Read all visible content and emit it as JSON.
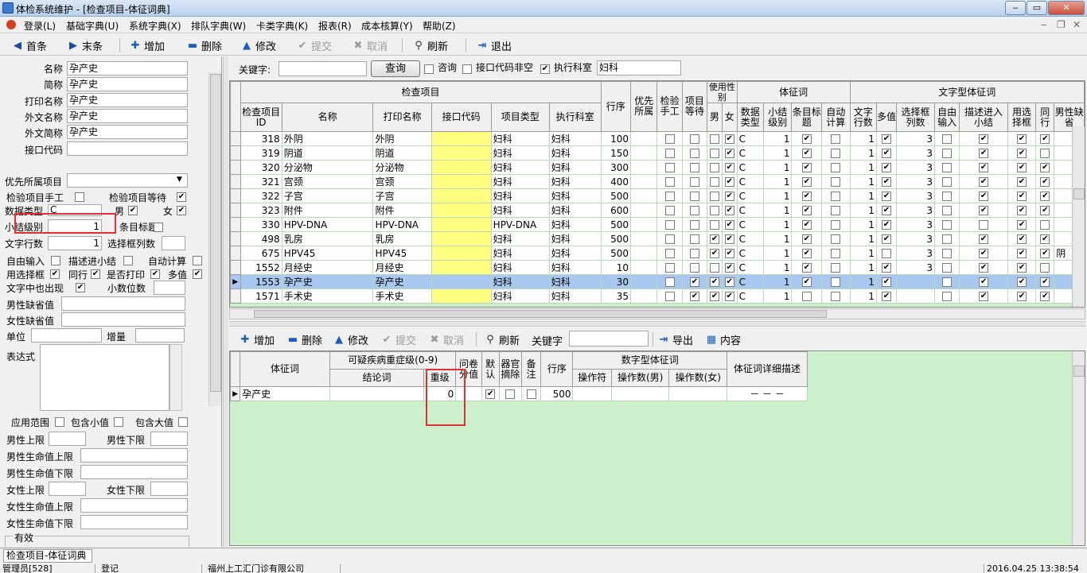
{
  "window": {
    "title": "体检系统维护 - [检查项目-体征词典]",
    "min": "‒",
    "max": "▭",
    "close": "✕"
  },
  "menu": [
    "登录(L)",
    "基础字典(U)",
    "系统字典(X)",
    "排队字典(W)",
    "卡类字典(K)",
    "报表(R)",
    "成本核算(Y)",
    "帮助(Z)"
  ],
  "mdi": {
    "min": "‒",
    "restore": "❐",
    "close": "✕"
  },
  "toolbar1": {
    "first": "首条",
    "last": "末条",
    "add": "增加",
    "delete": "删除",
    "edit": "修改",
    "submit": "提交",
    "cancel": "取消",
    "refresh": "刷新",
    "exit": "退出"
  },
  "form": {
    "name_label": "名称",
    "name": "孕产史",
    "short_label": "简称",
    "short": "孕产史",
    "print_label": "打印名称",
    "print": "孕产史",
    "foreign_label": "外文名称",
    "foreign": "孕产史",
    "foreign_short_label": "外文简称",
    "foreign_short": "孕产史",
    "iface_label": "接口代码",
    "iface": "",
    "priority_label": "优先所属项目",
    "priority": "",
    "manual_label": "检验项目手工",
    "wait_label": "检验项目等待",
    "dtype_label": "数据类型",
    "dtype": "C",
    "male_label": "男",
    "female_label": "女",
    "level_label": "小结级别",
    "level": "1",
    "title_label": "条目标题",
    "lines_label": "文字行数",
    "lines": "1",
    "colcount_label": "选择框列数",
    "colcount": "",
    "free_label": "自由输入",
    "desc_label": "描述进小结",
    "autocalc_label": "自动计算",
    "usebox_label": "用选择框",
    "sameline_label": "同行",
    "printyn_label": "是否打印",
    "multi_label": "多值",
    "textshow_label": "文字中也出现",
    "decimals_label": "小数位数",
    "decimals": "",
    "male_def_label": "男性缺省值",
    "male_def": "",
    "female_def_label": "女性缺省值",
    "female_def": "",
    "unit_label": "单位",
    "unit": "",
    "inc_label": "增量",
    "inc": "",
    "expr_label": "表达式",
    "expr": "",
    "range_label": "应用范围",
    "incmin_label": "包含小值",
    "incmax_label": "包含大值",
    "m_up_label": "男性上限",
    "m_up": "",
    "m_low_label": "男性下限",
    "m_low": "",
    "m_life_up_label": "男性生命值上限",
    "m_life_up": "",
    "m_life_low_label": "男性生命值下限",
    "m_life_low": "",
    "f_up_label": "女性上限",
    "f_up": "",
    "f_low_label": "女性下限",
    "f_low": "",
    "f_life_up_label": "女性生命值上限",
    "f_life_up": "",
    "f_life_low_label": "女性生命值下限",
    "f_life_low": "",
    "valid_label": "有效"
  },
  "search": {
    "kw_label": "关键字:",
    "kw": "",
    "query": "查询",
    "consult": "咨询",
    "iface_non": "接口代码非空",
    "dept": "执行科室",
    "dept_value": "妇科"
  },
  "grid1": {
    "group_main": "检查项目",
    "group_gender": "使用性别",
    "group_sign": "体征词",
    "group_text": "文字型体征词",
    "h_id": "检查项目ID",
    "h_name": "名称",
    "h_print": "打印名称",
    "h_iface": "接口代码",
    "h_type": "项目类型",
    "h_dept": "执行科室",
    "h_order": "行序",
    "h_pri": "优先所属",
    "h_manual": "检验手工",
    "h_wait": "项目等待",
    "h_m": "男",
    "h_f": "女",
    "h_dtype": "数据类型",
    "h_lvl": "小结级别",
    "h_ttl": "条目标题",
    "h_auto": "自动计算",
    "h_lines": "文字行数",
    "h_multi": "多值",
    "h_cols": "选择框列数",
    "h_free": "自由输入",
    "h_desc": "描述进入小结",
    "h_use": "用选择框",
    "h_same": "同行",
    "h_mdef": "男性缺省",
    "rows": [
      {
        "id": "318",
        "name": "外阴",
        "print": "外阴",
        "type": "妇科",
        "dept": "妇科",
        "order": "100",
        "pri": "",
        "manual": "",
        "wait": "",
        "m": "",
        "f": "✔",
        "dt": "C",
        "lvl": "1",
        "ttl": "✔",
        "auto": "",
        "lines": "1",
        "multi": "✔",
        "cols": "3",
        "free": "",
        "desc": "✔",
        "use": "✔",
        "same": "✔",
        "mdef": ""
      },
      {
        "id": "319",
        "name": "阴道",
        "print": "阴道",
        "type": "妇科",
        "dept": "妇科",
        "order": "150",
        "pri": "",
        "manual": "",
        "wait": "",
        "m": "",
        "f": "✔",
        "dt": "C",
        "lvl": "1",
        "ttl": "✔",
        "auto": "",
        "lines": "1",
        "multi": "✔",
        "cols": "3",
        "free": "",
        "desc": "✔",
        "use": "✔",
        "same": "",
        "mdef": ""
      },
      {
        "id": "320",
        "name": "分泌物",
        "print": "分泌物",
        "type": "妇科",
        "dept": "妇科",
        "order": "300",
        "pri": "",
        "manual": "",
        "wait": "",
        "m": "",
        "f": "✔",
        "dt": "C",
        "lvl": "1",
        "ttl": "✔",
        "auto": "",
        "lines": "1",
        "multi": "✔",
        "cols": "3",
        "free": "",
        "desc": "✔",
        "use": "✔",
        "same": "✔",
        "mdef": ""
      },
      {
        "id": "321",
        "name": "宫颈",
        "print": "宫颈",
        "type": "妇科",
        "dept": "妇科",
        "order": "400",
        "pri": "",
        "manual": "",
        "wait": "",
        "m": "",
        "f": "✔",
        "dt": "C",
        "lvl": "1",
        "ttl": "✔",
        "auto": "",
        "lines": "1",
        "multi": "✔",
        "cols": "3",
        "free": "",
        "desc": "✔",
        "use": "✔",
        "same": "✔",
        "mdef": ""
      },
      {
        "id": "322",
        "name": "子宫",
        "print": "子宫",
        "type": "妇科",
        "dept": "妇科",
        "order": "500",
        "pri": "",
        "manual": "",
        "wait": "",
        "m": "",
        "f": "✔",
        "dt": "C",
        "lvl": "1",
        "ttl": "✔",
        "auto": "",
        "lines": "1",
        "multi": "✔",
        "cols": "3",
        "free": "",
        "desc": "✔",
        "use": "✔",
        "same": "✔",
        "mdef": ""
      },
      {
        "id": "323",
        "name": "附件",
        "print": "附件",
        "type": "妇科",
        "dept": "妇科",
        "order": "600",
        "pri": "",
        "manual": "",
        "wait": "",
        "m": "",
        "f": "✔",
        "dt": "C",
        "lvl": "1",
        "ttl": "✔",
        "auto": "",
        "lines": "1",
        "multi": "✔",
        "cols": "3",
        "free": "",
        "desc": "✔",
        "use": "✔",
        "same": "✔",
        "mdef": ""
      },
      {
        "id": "330",
        "name": "HPV-DNA",
        "print": "HPV-DNA",
        "type": "HPV-DNA",
        "dept": "妇科",
        "order": "500",
        "pri": "",
        "manual": "",
        "wait": "",
        "m": "",
        "f": "✔",
        "dt": "C",
        "lvl": "1",
        "ttl": "✔",
        "auto": "",
        "lines": "1",
        "multi": "✔",
        "cols": "3",
        "free": "",
        "desc": "",
        "use": "✔",
        "same": "",
        "mdef": ""
      },
      {
        "id": "498",
        "name": "乳房",
        "print": "乳房",
        "type": "妇科",
        "dept": "妇科",
        "order": "500",
        "pri": "",
        "manual": "",
        "wait": "",
        "m": "✔",
        "f": "✔",
        "dt": "C",
        "lvl": "1",
        "ttl": "✔",
        "auto": "",
        "lines": "1",
        "multi": "✔",
        "cols": "3",
        "free": "",
        "desc": "✔",
        "use": "✔",
        "same": "✔",
        "mdef": ""
      },
      {
        "id": "675",
        "name": "HPV45",
        "print": "HPV45",
        "type": "妇科",
        "dept": "妇科",
        "order": "500",
        "pri": "",
        "manual": "",
        "wait": "",
        "m": "✔",
        "f": "✔",
        "dt": "C",
        "lvl": "1",
        "ttl": "✔",
        "auto": "",
        "lines": "1",
        "multi": "",
        "cols": "3",
        "free": "",
        "desc": "✔",
        "use": "✔",
        "same": "✔",
        "mdef": "阴"
      },
      {
        "id": "1552",
        "name": "月经史",
        "print": "月经史",
        "type": "妇科",
        "dept": "妇科",
        "order": "10",
        "pri": "",
        "manual": "",
        "wait": "",
        "m": "",
        "f": "✔",
        "dt": "C",
        "lvl": "1",
        "ttl": "✔",
        "auto": "",
        "lines": "1",
        "multi": "✔",
        "cols": "3",
        "free": "",
        "desc": "✔",
        "use": "✔",
        "same": "",
        "mdef": ""
      },
      {
        "id": "1553",
        "name": "孕产史",
        "print": "孕产史",
        "type": "妇科",
        "dept": "妇科",
        "order": "30",
        "pri": "",
        "manual": "",
        "wait": "✔",
        "m": "✔",
        "f": "✔",
        "dt": "C",
        "lvl": "1",
        "ttl": "✔",
        "auto": "",
        "lines": "1",
        "multi": "✔",
        "cols": "",
        "free": "",
        "desc": "✔",
        "use": "✔",
        "same": "✔",
        "mdef": "",
        "sel": true
      },
      {
        "id": "1571",
        "name": "手术史",
        "print": "手术史",
        "type": "妇科",
        "dept": "妇科",
        "order": "35",
        "pri": "",
        "manual": "",
        "wait": "✔",
        "m": "✔",
        "f": "✔",
        "dt": "C",
        "lvl": "1",
        "ttl": "",
        "auto": "",
        "lines": "1",
        "multi": "✔",
        "cols": "",
        "free": "",
        "desc": "✔",
        "use": "✔",
        "same": "✔",
        "mdef": ""
      }
    ]
  },
  "toolbar2": {
    "add": "增加",
    "delete": "删除",
    "edit": "修改",
    "submit": "提交",
    "cancel": "取消",
    "refresh": "刷新",
    "kw_label": "关键字",
    "kw": "",
    "export": "导出",
    "content": "内容"
  },
  "grid2": {
    "h_word": "体征词",
    "h_group": "可疑疾病重症级(0-9)",
    "h_concl": "结论词",
    "h_weight": "重级",
    "h_quest": "问卷分值",
    "h_def": "默认",
    "h_dev": "器官摘除",
    "h_note": "备注",
    "h_order": "行序",
    "h_numgroup": "数字型体征词",
    "h_op": "操作符",
    "h_opm": "操作数(男)",
    "h_opf": "操作数(女)",
    "h_detail": "体征词详细描述",
    "rows": [
      {
        "word": "孕产史",
        "concl": "",
        "weight": "0",
        "quest": "",
        "def": "✔",
        "dev": "",
        "note": "",
        "order": "500",
        "op": "",
        "opm": "",
        "opf": "",
        "detail": "－ － －"
      }
    ]
  },
  "status": {
    "tab": "检查项目-体征词典",
    "user": "管理员[528]",
    "state": "登记",
    "company": "福州上工汇门诊有限公司",
    "time": "2016.04.25 13:38:54"
  }
}
